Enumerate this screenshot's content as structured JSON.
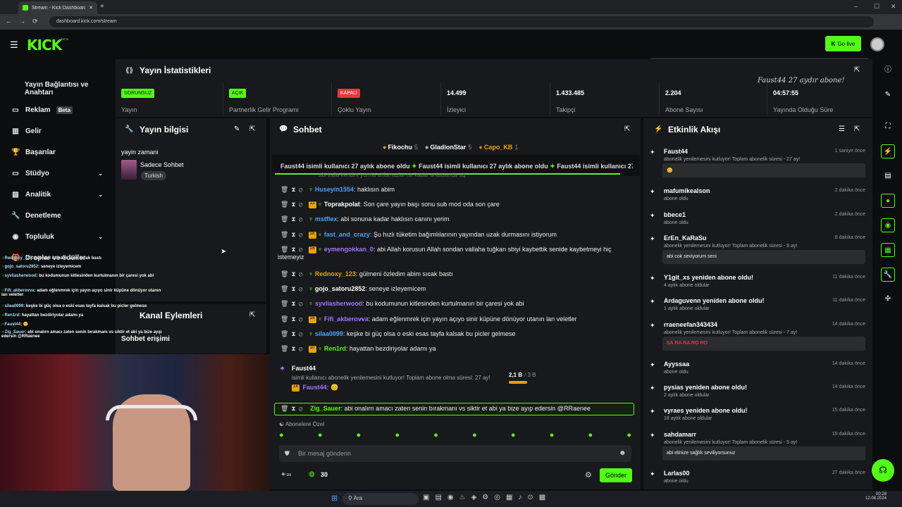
{
  "browser": {
    "tab_title": "Stream - Kick Dashboard",
    "url": "dashboard.kick.com/stream"
  },
  "topnav": {
    "logo": "KICK",
    "beta": "BETA",
    "go_live": "Go live"
  },
  "sidebar": [
    {
      "label": "Yayın",
      "icon": "broadcast-icon",
      "active": true
    },
    {
      "label": "Yayın Bağlantısı ve Anahtarı",
      "icon": "",
      "active": false
    },
    {
      "label": "Reklam",
      "icon": "ad-icon",
      "badge": "Beta"
    },
    {
      "label": "Gelir",
      "icon": "chart-icon"
    },
    {
      "label": "Başarılar",
      "icon": "trophy-icon"
    },
    {
      "label": "Stüdyo",
      "icon": "studio-icon",
      "chevron": true
    },
    {
      "label": "Analitik",
      "icon": "analytics-icon",
      "chevron": true
    },
    {
      "label": "Denetleme",
      "icon": "wrench-icon"
    },
    {
      "label": "Topluluk",
      "icon": "community-icon",
      "chevron": true
    },
    {
      "label": "Droplar ve ödüller",
      "icon": "gift-icon"
    }
  ],
  "stats": {
    "title": "Yayın İstatistikleri",
    "items": [
      {
        "tag": "SORUNSUZ",
        "tag_color": "#53fc18",
        "label": "Yayın"
      },
      {
        "tag": "AÇIK",
        "tag_color": "#53fc18",
        "label": "Partnerlik Gelir Programı"
      },
      {
        "tag": "KAPALI",
        "tag_color": "#e5383b",
        "label": "Çoklu Yayın"
      },
      {
        "value": "14.499",
        "label": "İzleyici"
      },
      {
        "value": "1.433.485",
        "label": "Takipçi"
      },
      {
        "value": "2.204",
        "label": "Abone Sayısı"
      },
      {
        "value": "04:57:55",
        "label": "Yayında Olduğu Süre"
      }
    ],
    "overlay_text": "Faust44 27 aydır abone!"
  },
  "stream_info": {
    "title": "Yayın bilgisi",
    "heading": "yayin zamani",
    "category": "Sadece Sohbet",
    "language": "Turkish"
  },
  "channel_actions": {
    "title": "Kanal Eylemleri",
    "item": "Sohbet erişimi"
  },
  "chat": {
    "title": "Sohbet",
    "top_gifters": [
      {
        "name": "Fikochu",
        "count": "5"
      },
      {
        "name": "GladionStar",
        "count": "5"
      },
      {
        "name": "Capo_KB",
        "count": "1"
      }
    ],
    "pinned_ticker": "Faust44 isimli kullanıcı 27 aylık abone oldu",
    "partial_line": "abi valla kendini yorma anlamazlar ne kadar anlatsanda aq",
    "messages": [
      {
        "badge": "",
        "name": "Huseyin1554",
        "color": "#4aa3ff",
        "text": ": haklısın abim"
      },
      {
        "badge": "13",
        "name": "Toprakpolat",
        "color": "#ffffff",
        "text": ": Son çare yayın başı sonu sub mod oda son çare"
      },
      {
        "badge": "",
        "name": "mstflex",
        "color": "#4aa3ff",
        "text": ": abi sonuna kadar haklısın canını yerim"
      },
      {
        "badge": "18",
        "name": "fast_and_crazy",
        "color": "#4aa3ff",
        "text": ": Şu hızlı tüketim bağımlılarının yayından uzak durmasını istiyorum"
      },
      {
        "badge": "16",
        "name": "eymengokkan_0",
        "color": "#a274ff",
        "text": ": abi Allah korusun Allah sondan vallaha tuğkan sbiyi kaybettik senide kaybetmeyi hiç",
        "cont": "istemeyiz"
      },
      {
        "badge": "",
        "name": "Rednoxy_123",
        "color": "#e8a20d",
        "text": ": gülmeni özledim abim sıcak bastı"
      },
      {
        "badge": "",
        "name": "gojo_satoru2852",
        "color": "#ffffff",
        "text": ": seneye izleyemicem"
      },
      {
        "badge": "",
        "name": "syvliasherwood",
        "color": "#a274ff",
        "text": ": bu kodumunun kitlesinden kurtulmanın bir çaresi yok abi"
      },
      {
        "badge": "16",
        "name": "Fifi_akberovva",
        "color": "#a274ff",
        "text": ": adam eğlenmrek için yayın açıyo sinir küpüne dönüyor utanın lan veletler"
      },
      {
        "badge": "",
        "name": "silaa0099",
        "color": "#4aa3ff",
        "text": ": keşke bi güç olsa o eski esas tayfa kalsak bu picler gelmese"
      },
      {
        "badge": "10",
        "name": "Ren1rd",
        "color": "#53fc18",
        "text": ": hayattan bezdiriyolar adamı ya"
      }
    ],
    "sub_event": {
      "name": "Faust44",
      "text": "isimli kullanıcı abonelik yenilemesini kutluyor! Toplam abone olma süresi: 27 ay!",
      "badge": "14",
      "reply": "Faust44:",
      "progress": "2,1 B",
      "progress_total": "/ 3 B"
    },
    "highlight": {
      "name": "Zig_Sauer",
      "text": ": abi onalırn amacı zaten senin bırakmanı vs siktir et abi ya bize ayıp edersin @RRaenee"
    },
    "emote_label": "Abonelere Özel",
    "input_placeholder": "Bir mesaj gönderin",
    "points": "30",
    "send": "Gönder"
  },
  "activity": {
    "title": "Etkinlik Akışı",
    "items": [
      {
        "name": "Faust44",
        "time": "1 saniye önce",
        "desc": "abonelik yenilemesini kutluyor! Toplam abonelik süresi - 27 ay!",
        "box": "😊"
      },
      {
        "name": "mafumikealson",
        "time": "2 dakika önce",
        "desc": "abone oldu"
      },
      {
        "name": "bbece1",
        "time": "2 dakika önce",
        "desc": "abone oldu"
      },
      {
        "name": "ErEn_KaRaSu",
        "time": "8 dakika önce",
        "desc": "abonelik yenilemesini kutluyor! Toplam abonelik süresi - 9 ay!",
        "box": "abi cok seviyorum seni"
      },
      {
        "name": "Y1git_xs yeniden abone oldu!",
        "time": "11 dakika önce",
        "desc": "4 aylık abone oldular"
      },
      {
        "name": "Ardaguvenn yeniden abone oldu!",
        "time": "11 dakika önce",
        "desc": "1 aylık abone oldular"
      },
      {
        "name": "rraeneefan343434",
        "time": "14 dakika önce",
        "desc": "abonelik yenilemesini kutluyor! Toplam abonelik süresi - 7 ay!",
        "box": "SA RA RA RO RO"
      },
      {
        "name": "Ayyssaa",
        "time": "14 dakika önce",
        "desc": "abone oldu"
      },
      {
        "name": "pysias yeniden abone oldu!",
        "time": "14 dakika önce",
        "desc": "2 aylık abone oldular"
      },
      {
        "name": "vyraes yeniden abone oldu!",
        "time": "15 dakika önce",
        "desc": "18 aylık abone oldular"
      },
      {
        "name": "sahdamarr",
        "time": "19 dakika önce",
        "desc": "abonelik yenilemesini kutluyor! Toplam abonelik süresi - 5 ay!",
        "box": "abi elinize sağlık seviliyorsunuz"
      },
      {
        "name": "Larlas00",
        "time": "27 dakika önce",
        "desc": "abone oldu"
      }
    ]
  },
  "overlay_chat": [
    {
      "name": "Rednoxy_123",
      "text": ": gülmeni özledim abim sıcak bastı"
    },
    {
      "name": "gojo_satoru2852",
      "text": ": seneye izleyemicem"
    },
    {
      "name": "syvliasherwood",
      "text": ": bu kodumunun kitlesinden kurtulmanın bir çaresi yok abi"
    },
    {
      "name": "Fifi_akberovva",
      "text": ": adam eğlenmrek için yayın açıyo sinir küpüne dönüyor utanın lan veletler"
    },
    {
      "name": "silaa0099",
      "text": ": keşke bi güç olsa o eski esas tayfa kalsak bu picler gelmese"
    },
    {
      "name": "Ren1rd",
      "text": ": hayattan bezdiriyolar adamı ya"
    },
    {
      "name": "Faust44",
      "text": ": 😊"
    },
    {
      "name": "Zig_Sauer",
      "text": ": abi onalırn amacı zaten senin bırakmanı vs siktir et abi ya bize ayıp edersin @RRaenee"
    }
  ],
  "taskbar": {
    "search": "Ara",
    "time": "00:28",
    "date": "12.08.2024"
  }
}
